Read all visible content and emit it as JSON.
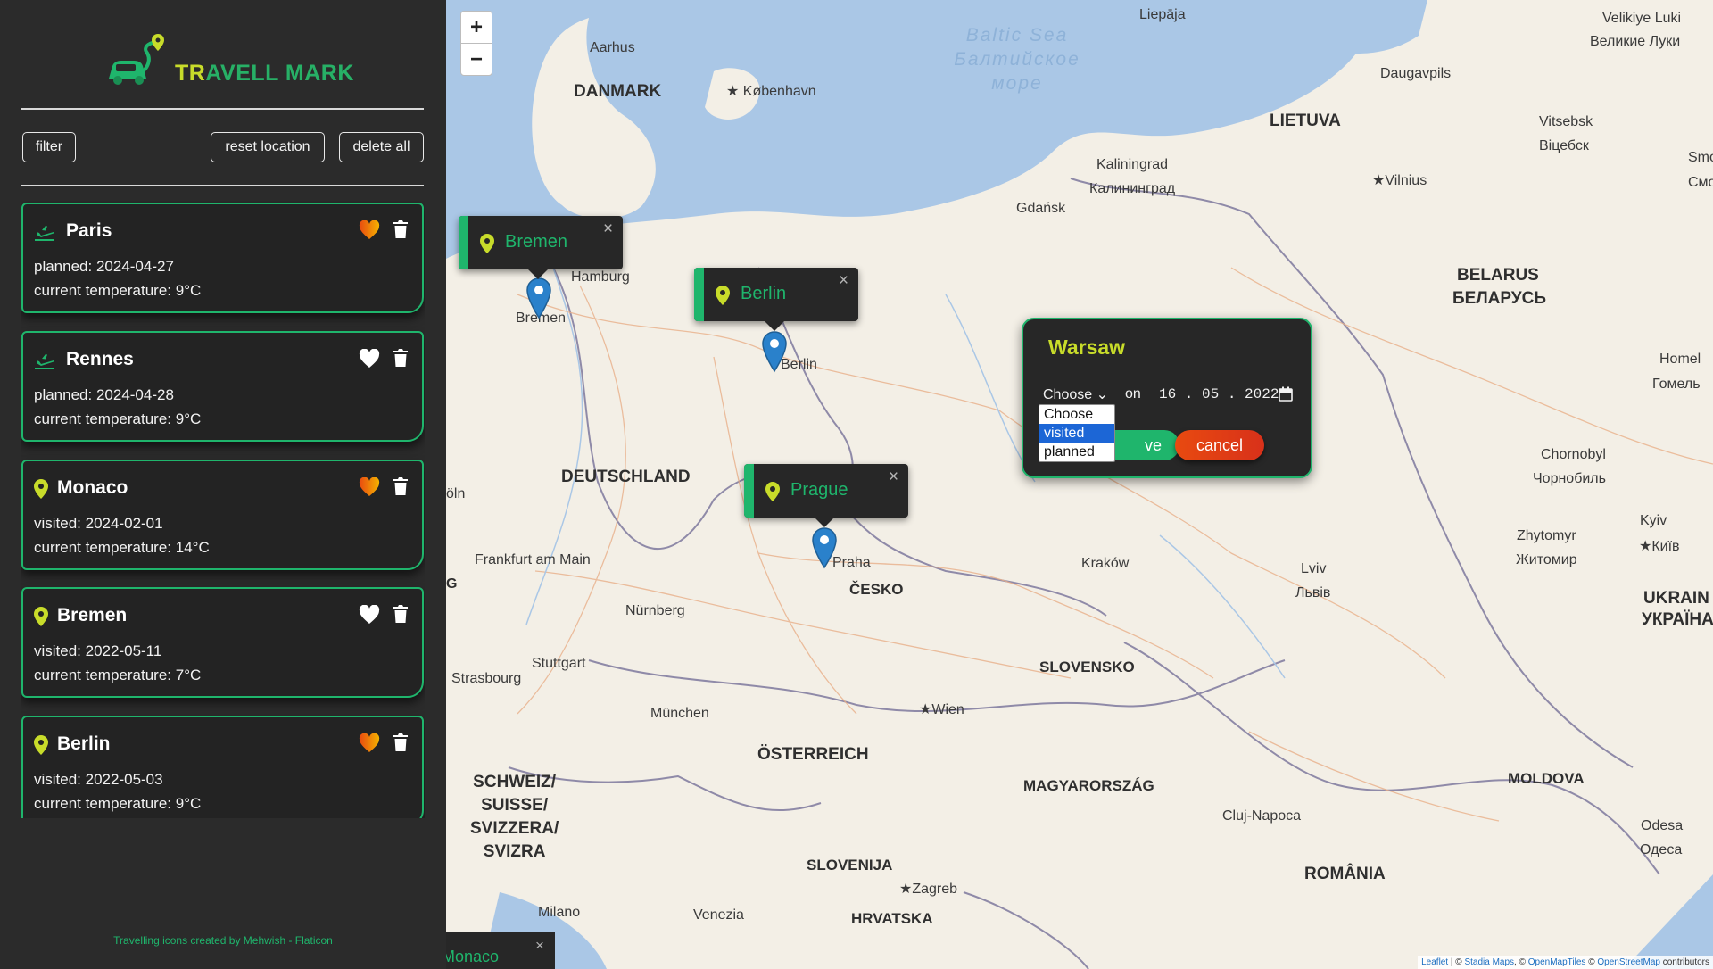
{
  "app": {
    "logo_part1": "TR",
    "logo_part2": "AVELL MARK",
    "credit": "Travelling icons created by Mehwish - Flaticon"
  },
  "toolbar": {
    "filter_label": "filter",
    "reset_label": "reset location",
    "delete_all_label": "delete all"
  },
  "cards": [
    {
      "city": "Paris",
      "icon": "plane-icon",
      "liked": true,
      "line1": "planned: 2024-04-27",
      "line2": "current temperature: 9°C"
    },
    {
      "city": "Rennes",
      "icon": "plane-icon",
      "liked": false,
      "line1": "planned: 2024-04-28",
      "line2": "current temperature: 9°C"
    },
    {
      "city": "Monaco",
      "icon": "map-pin-icon",
      "liked": true,
      "line1": "visited: 2024-02-01",
      "line2": "current temperature: 14°C"
    },
    {
      "city": "Bremen",
      "icon": "map-pin-icon",
      "liked": false,
      "line1": "visited: 2022-05-11",
      "line2": "current temperature: 7°C"
    },
    {
      "city": "Berlin",
      "icon": "map-pin-icon",
      "liked": true,
      "line1": "visited: 2022-05-03",
      "line2": "current temperature: 9°C"
    }
  ],
  "map": {
    "zoom_in": "+",
    "zoom_out": "−",
    "close_symbol": "×",
    "popups": {
      "bremen": "Bremen",
      "berlin": "Berlin",
      "prague": "Prague",
      "monaco": "Monaco"
    },
    "labels": {
      "liepaja": "Liepāja",
      "velikiye1": "Velikiye Luki",
      "velikiye2": "Великие Луки",
      "baltic1": "Baltic Sea",
      "baltic2": "Балтийское",
      "baltic3": "море",
      "aarhus": "Aarhus",
      "danmark": "DANMARK",
      "kobenhavn": "København",
      "daugavpils": "Daugavpils",
      "lietuva": "LIETUVA",
      "vitsebsk1": "Vitsebsk",
      "vitsebsk2": "Віцебск",
      "smo1": "Smo",
      "smo2": "Смо",
      "kaliningrad1": "Kaliningrad",
      "kaliningrad2": "Калининград",
      "vilnius": "Vilnius",
      "gdansk": "Gdańsk",
      "hamburg": "Hamburg",
      "bremen": "Bremen",
      "berlin": "Berlin",
      "belarus1": "BELARUS",
      "belarus2": "БЕЛАРУСЬ",
      "homel1": "Homel",
      "homel2": "Гомель",
      "deutschland": "DEUTSCHLAND",
      "koln": "öln",
      "chornobyl1": "Chornobyl",
      "chornobyl2": "Чорнобиль",
      "kyiv1": "Kyiv",
      "kyiv2": "Київ",
      "zhytomyr1": "Zhytomyr",
      "zhytomyr2": "Житомир",
      "frankfurt": "Frankfurt am Main",
      "praha": "Praha",
      "cesko": "ČESKO",
      "krakow": "Kraków",
      "lviv1": "Lviv",
      "lviv2": "Львів",
      "ukraine1": "UKRAIN",
      "ukraine2": "УКРАЇНА",
      "nurnberg": "Nürnberg",
      "g": "G",
      "stuttgart": "Stuttgart",
      "strasbourg": "Strasbourg",
      "slovensko": "SLOVENSKO",
      "wien": "Wien",
      "munchen": "München",
      "osterreich": "ÖSTERREICH",
      "magyar": "MAGYARORSZÁG",
      "moldova": "MOLDOVA",
      "schweiz1": "SCHWEIZ/",
      "schweiz2": "SUISSE/",
      "schweiz3": "SVIZZERA/",
      "schweiz4": "SVIZRA",
      "cluj": "Cluj-Napoca",
      "odesa1": "Odesa",
      "odesa2": "Одеса",
      "slovenija": "SLOVENIJA",
      "zagreb": "Zagreb",
      "romania": "ROMÂNIA",
      "milano": "Milano",
      "venezia": "Venezia",
      "hrvatska": "HRVATSKA"
    },
    "attribution": {
      "leaflet": "Leaflet",
      "sep1": " | © ",
      "stadia": "Stadia Maps",
      "sep2": ", © ",
      "omt": "OpenMapTiles",
      "sep3": " © ",
      "osm": "OpenStreetMap",
      "contrib": " contributors"
    }
  },
  "form": {
    "title": "Warsaw",
    "select_value": "Choose",
    "on_label": "on",
    "date_value": "16 . 05 . 2022",
    "save_label": "ve",
    "cancel_label": "cancel",
    "options": [
      "Choose",
      "visited",
      "planned"
    ],
    "highlighted_option": "visited"
  },
  "colors": {
    "accent": "#1fb56c",
    "logo_yellow": "#c8dc2a",
    "cancel": "#e84a10",
    "marker": "#2a81cb"
  }
}
